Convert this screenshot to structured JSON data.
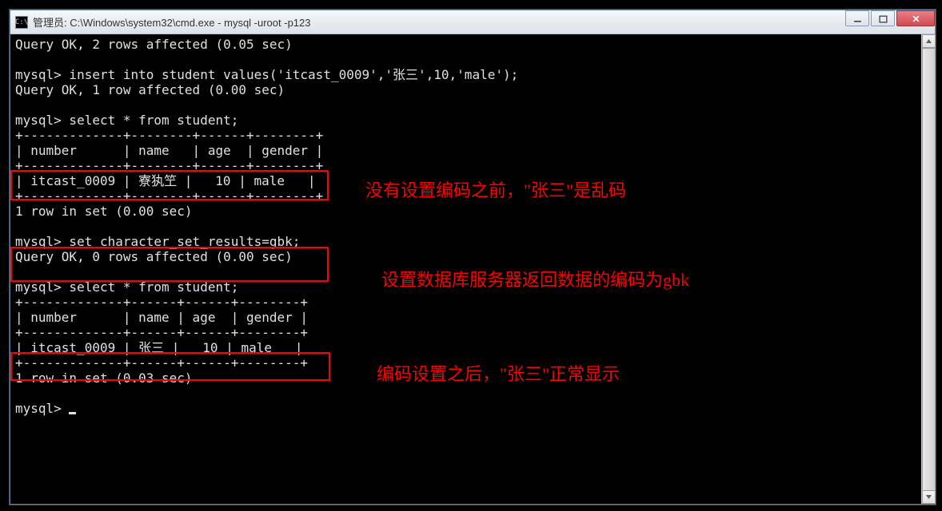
{
  "titlebar": {
    "icon_text": "C:\\",
    "title": "管理员: C:\\Windows\\system32\\cmd.exe - mysql  -uroot -p123"
  },
  "terminal": {
    "line1": "Query OK, 2 rows affected (0.05 sec)",
    "line2": "",
    "line3": "mysql> insert into student values('itcast_0009','张三',10,'male');",
    "line4": "Query OK, 1 row affected (0.00 sec)",
    "line5": "",
    "line6": "mysql> select * from student;",
    "line7": "+-------------+--------+------+--------+",
    "line8": "| number      | name   | age  | gender |",
    "line9": "+-------------+--------+------+--------+",
    "line10": "| itcast_0009 | 寮犱笁 |   10 | male   |",
    "line11": "+-------------+--------+------+--------+",
    "line12": "1 row in set (0.00 sec)",
    "line13": "",
    "line14": "mysql> set character_set_results=gbk;",
    "line15": "Query OK, 0 rows affected (0.00 sec)",
    "line16": "",
    "line17": "mysql> select * from student;",
    "line18": "+-------------+------+------+--------+",
    "line19": "| number      | name | age  | gender |",
    "line20": "+-------------+------+------+--------+",
    "line21": "| itcast_0009 | 张三 |   10 | male   |",
    "line22": "+-------------+------+------+--------+",
    "line23": "1 row in set (0.03 sec)",
    "line24": "",
    "prompt": "mysql> "
  },
  "annotations": {
    "a1": "没有设置编码之前，\"张三\"是乱码",
    "a2": "设置数据库服务器返回数据的编码为gbk",
    "a3": "编码设置之后，\"张三\"正常显示"
  }
}
